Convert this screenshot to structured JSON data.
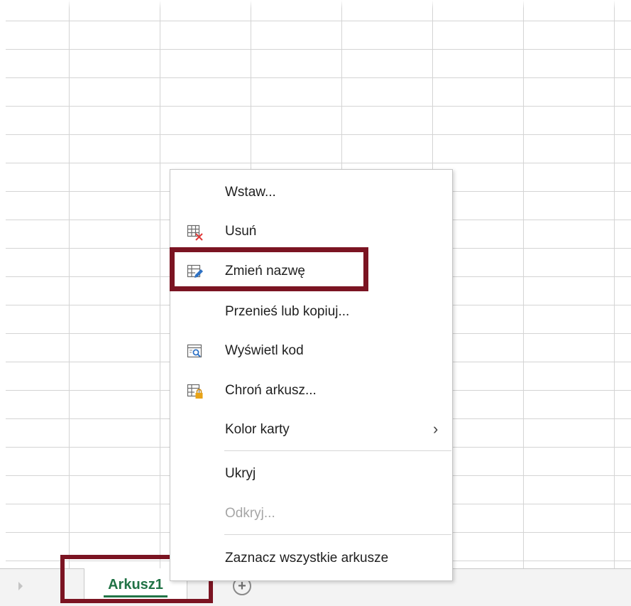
{
  "menu": {
    "items": [
      {
        "label": "Wstaw...",
        "disabled": false,
        "icon": "none"
      },
      {
        "label": "Usuń",
        "disabled": false,
        "icon": "delete-sheet-icon"
      },
      {
        "label": "Zmień nazwę",
        "disabled": false,
        "icon": "rename-sheet-icon"
      },
      {
        "label": "Przenieś lub kopiuj...",
        "disabled": false,
        "icon": "none"
      },
      {
        "label": "Wyświetl kod",
        "disabled": false,
        "icon": "view-code-icon"
      },
      {
        "label": "Chroń arkusz...",
        "disabled": false,
        "icon": "protect-sheet-icon"
      },
      {
        "label": "Kolor karty",
        "disabled": false,
        "icon": "none",
        "submenu": "chevron-right-icon"
      },
      {
        "label": "Ukryj",
        "disabled": false,
        "icon": "none"
      },
      {
        "label": "Odkryj...",
        "disabled": true,
        "icon": "none"
      },
      {
        "label": "Zaznacz wszystkie arkusze",
        "disabled": false,
        "icon": "none"
      }
    ]
  },
  "sheets": {
    "active_tab": "Arkusz1",
    "add_symbol": "+"
  },
  "colors": {
    "accent_green": "#217346",
    "highlight": "#7b1422"
  }
}
